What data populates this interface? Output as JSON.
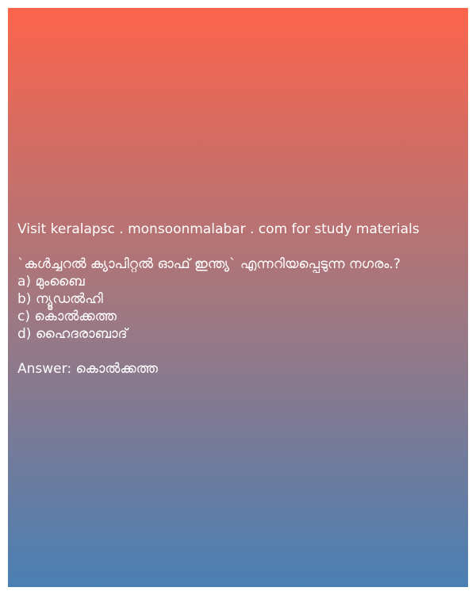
{
  "site_text": "Visit keralapsc . monsoonmalabar . com for study materials",
  "question": " `കൾച്ചറൽ ക്യാപിറ്റൽ ഓഫ് ഇന്ത്യ` എന്നറിയപ്പെടുന്ന നഗരം.?",
  "options": [
    "a) മുംബൈ",
    "b) ന്യൂഡൽഹി",
    "c) കൊൽക്കത്ത",
    "d) ഹൈദരാബാദ്"
  ],
  "answer": "Answer: കൊൽക്കത്ത",
  "colors": {
    "gradient_top": "#fd644c",
    "gradient_middle": "#a3777f",
    "gradient_bottom": "#4a7fb3",
    "text": "#ffffff"
  }
}
